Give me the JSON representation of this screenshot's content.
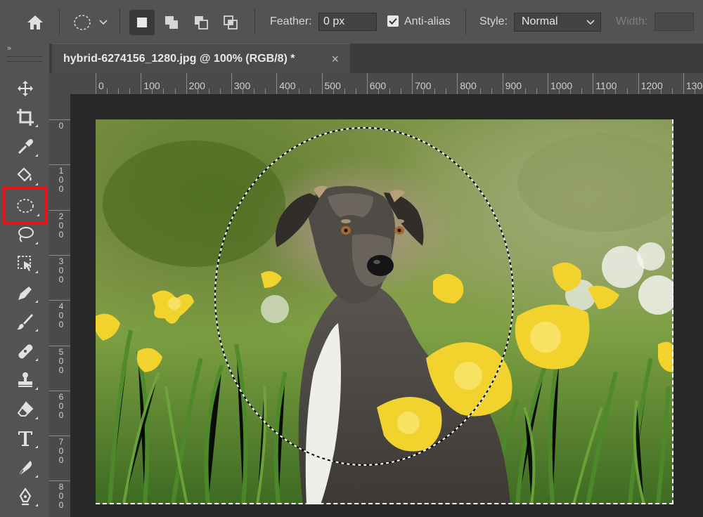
{
  "options_bar": {
    "feather_label": "Feather:",
    "feather_value": "0 px",
    "antialias_label": "Anti-alias",
    "antialias_checked": true,
    "style_label": "Style:",
    "style_value": "Normal",
    "width_label": "Width:",
    "width_value": ""
  },
  "toolbar": {
    "collapse_label": "»",
    "tools": [
      "move-tool",
      "crop-tool",
      "eyedropper-tool",
      "paint-bucket-tool",
      "elliptical-marquee-tool",
      "lasso-tool",
      "object-selection-tool",
      "pen-curvature-tool",
      "brush-tool",
      "healing-brush-tool",
      "clone-stamp-tool",
      "eraser-tool",
      "type-tool",
      "smudge-tool",
      "pen-tool"
    ],
    "selected_tool": "elliptical-marquee-tool"
  },
  "document_tab": {
    "title": "hybrid-6274156_1280.jpg @ 100% (RGB/8) *",
    "close_label": "×"
  },
  "rulers": {
    "horizontal": [
      "0",
      "100",
      "200",
      "300",
      "400",
      "500",
      "600",
      "700",
      "800",
      "900",
      "1000",
      "1100",
      "1200",
      "1300"
    ],
    "vertical": [
      "0",
      "100",
      "200",
      "300",
      "400",
      "500",
      "600",
      "700",
      "800"
    ]
  },
  "accent_colors": {
    "highlight_box": "#e8141c",
    "panel_bg": "#535353",
    "canvas_bg": "#282828"
  }
}
